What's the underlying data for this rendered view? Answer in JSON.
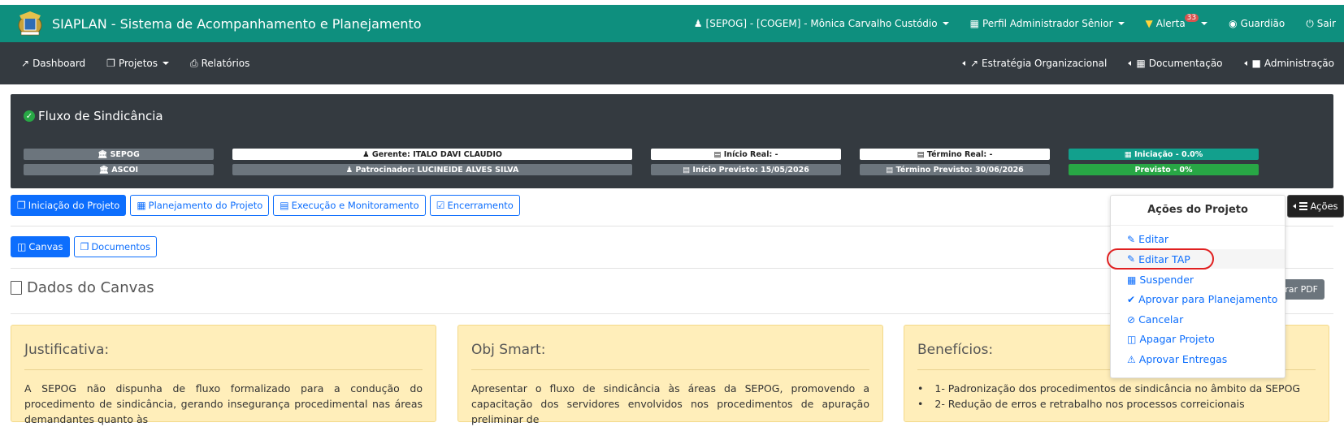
{
  "app": {
    "title": "SIAPLAN - Sistema de Acompanhamento e Planejamento",
    "accent": "#0e8f7e"
  },
  "topnav": {
    "user": "[SEPOG] - [COGEM] - Mônica Carvalho Custódio",
    "profile": "Perfil Administrador Sênior",
    "alert": "Alerta",
    "alert_count": "33",
    "guardian": "Guardião",
    "exit": "Sair"
  },
  "mainnav": {
    "dashboard": "Dashboard",
    "projects": "Projetos",
    "reports": "Relatórios",
    "strategy": "Estratégia Organizacional",
    "docs": "Documentação",
    "admin": "Administração"
  },
  "project": {
    "title": "Fluxo de Sindicância",
    "org1": "SEPOG",
    "org2": "ASCOI",
    "manager": "Gerente: ITALO DAVI CLAUDIO",
    "sponsor": "Patrocinador: LUCINEIDE ALVES SILVA",
    "real_start": "Início Real: -",
    "planned_start": "Início Previsto: 15/05/2026",
    "real_end": "Término Real: -",
    "planned_end": "Término Previsto: 30/06/2026",
    "phase": "Iniciação - 0.0%",
    "planned": "Previsto - 0%"
  },
  "tabs": {
    "initiation": "Iniciação do Projeto",
    "planning": "Planejamento do Projeto",
    "execution": "Execução e Monitoramento",
    "closing": "Encerramento"
  },
  "subtabs": {
    "canvas": "Canvas",
    "documents": "Documentos"
  },
  "actions_button": "Ações",
  "section_title": "Dados do Canvas",
  "pdf_button": "erar PDF",
  "cards": [
    {
      "title": "Justificativa:",
      "text": "A SEPOG não dispunha de fluxo formalizado para a condução do procedimento de sindicância, gerando insegurança procedimental nas áreas demandantes quanto às"
    },
    {
      "title": "Obj Smart:",
      "text": "Apresentar o fluxo de sindicância às áreas da SEPOG, promovendo a capacitação dos servidores envolvidos nos procedimentos de apuração preliminar de"
    },
    {
      "title": "Benefícios:",
      "items": [
        "1- Padronização dos procedimentos de sindicância no âmbito da SEPOG",
        "2- Redução de erros e retrabalho nos processos correicionais"
      ]
    }
  ],
  "dropdown": {
    "header": "Ações do Projeto",
    "items": [
      "Editar",
      "Editar TAP",
      "Suspender",
      "Aprovar para Planejamento",
      "Cancelar",
      "Apagar Projeto",
      "Aprovar Entregas"
    ]
  }
}
